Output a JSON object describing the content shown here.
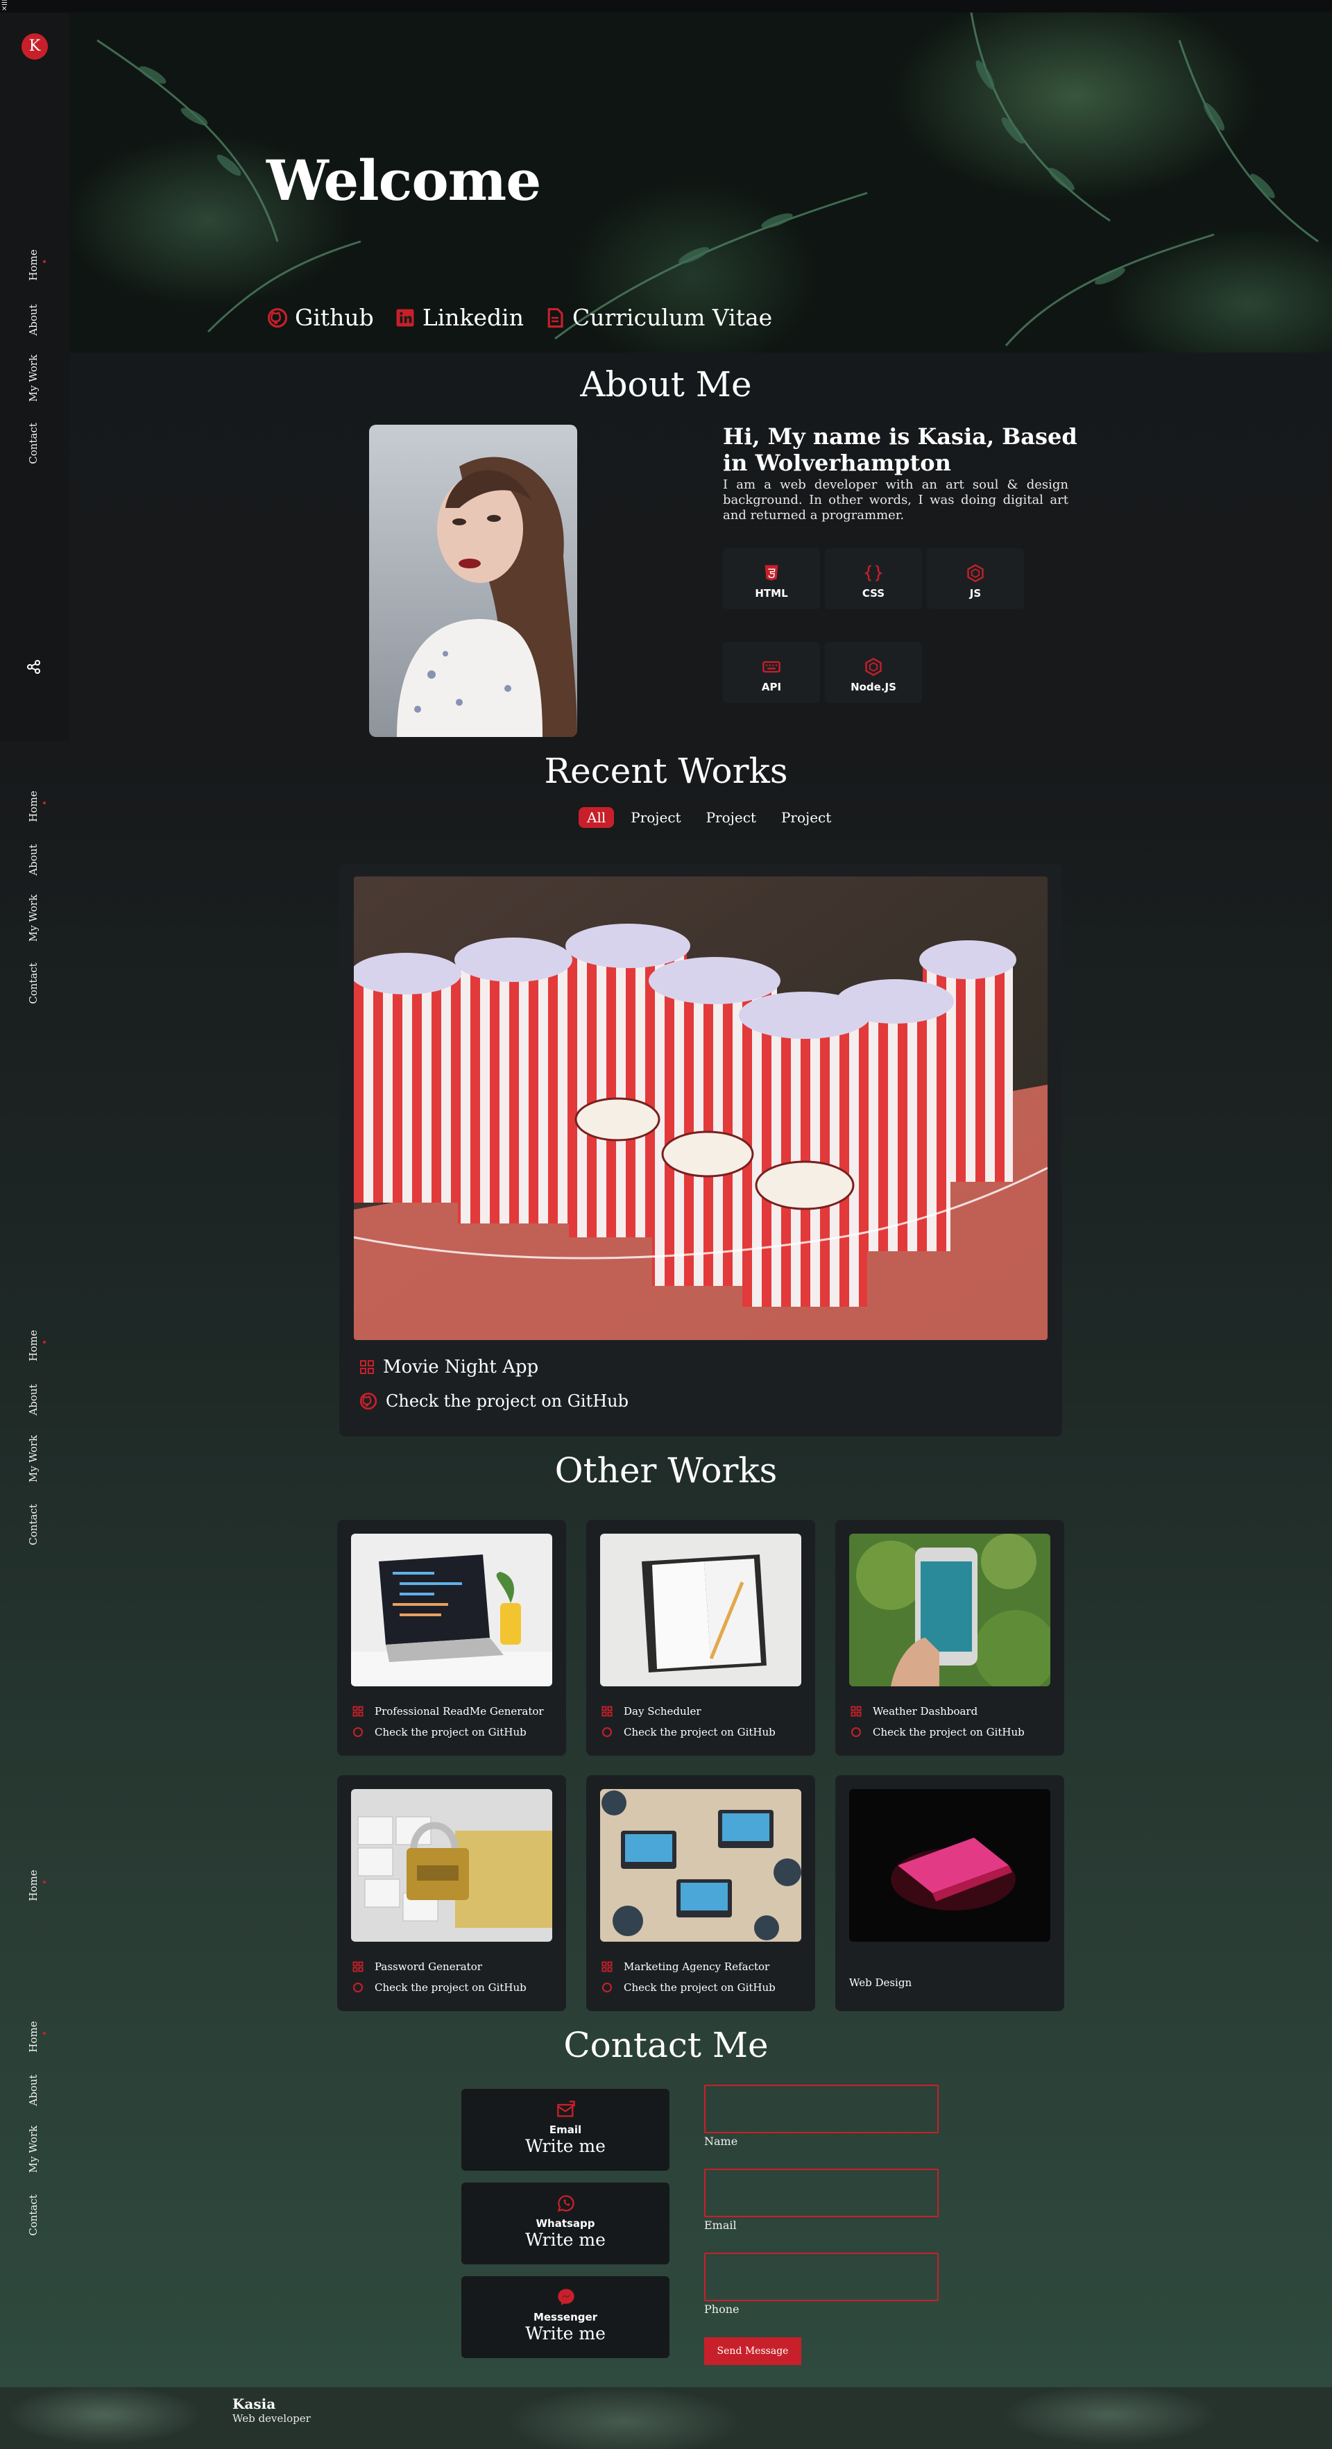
{
  "colors": {
    "accent": "#c8202a",
    "card": "#1c1f22",
    "bg": "#17191b"
  },
  "menu_glyph": "☰",
  "close_glyph": "×",
  "logo": "K",
  "nav": {
    "home": "Home",
    "about": "About",
    "work": "My Work",
    "contact": "Contact"
  },
  "hero": {
    "title": "Welcome",
    "links": [
      {
        "label": "Github",
        "icon": "github-icon"
      },
      {
        "label": "Linkedin",
        "icon": "linkedin-icon"
      },
      {
        "label": "Curriculum Vitae",
        "icon": "document-icon"
      }
    ]
  },
  "about": {
    "title": "About Me",
    "heading": "Hi, My name is Kasia, Based in Wolverhampton",
    "text": "I am a web developer with an art soul & design background. In other words, I was doing digital art and returned a programmer.",
    "skills": [
      "HTML",
      "CSS",
      "JS",
      "API",
      "Node.JS"
    ]
  },
  "recent": {
    "title": "Recent Works",
    "filters": [
      "All",
      "Project",
      "Project",
      "Project"
    ],
    "featured": {
      "name": "Movie Night App",
      "link": "Check the project on GitHub"
    }
  },
  "other": {
    "title": "Other Works",
    "items": [
      {
        "name": "Professional ReadMe Generator",
        "link": "Check the project on GitHub"
      },
      {
        "name": "Day Scheduler",
        "link": "Check the project on GitHub"
      },
      {
        "name": "Weather Dashboard",
        "link": "Check the project on GitHub"
      },
      {
        "name": "Password Generator",
        "link": "Check the project on GitHub"
      },
      {
        "name": "Marketing Agency Refactor",
        "link": "Check the project on GitHub"
      },
      {
        "name": "Web Design"
      }
    ]
  },
  "contact": {
    "title": "Contact Me",
    "cards": [
      {
        "label": "Email",
        "sub": "Write me",
        "icon": "mail-icon"
      },
      {
        "label": "Whatsapp",
        "sub": "Write me",
        "icon": "whatsapp-icon"
      },
      {
        "label": "Messenger",
        "sub": "Write me",
        "icon": "messenger-icon"
      }
    ],
    "fields": [
      "Name",
      "Email",
      "Phone"
    ],
    "send": "Send Message"
  },
  "footer": {
    "name": "Kasia",
    "role": "Web developer"
  }
}
